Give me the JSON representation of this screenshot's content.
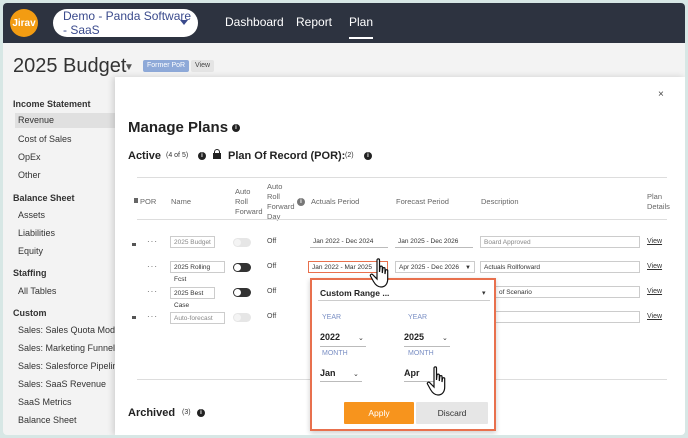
{
  "topbar": {
    "logo_text": "Jirav",
    "workspace": "Demo - Panda Software - SaaS",
    "nav": [
      "Dashboard",
      "Report",
      "Plan"
    ],
    "active_nav": "Plan"
  },
  "page": {
    "title": "2025 Budget",
    "badges": [
      "Former PoR",
      "View"
    ]
  },
  "sidebar": {
    "income_statement": {
      "heading": "Income Statement",
      "items": [
        "Revenue",
        "Cost of Sales",
        "OpEx",
        "Other"
      ],
      "selected": "Revenue"
    },
    "balance_sheet": {
      "heading": "Balance Sheet",
      "items": [
        "Assets",
        "Liabilities",
        "Equity"
      ]
    },
    "staffing": {
      "heading": "Staffing",
      "items": [
        "All Tables"
      ]
    },
    "custom": {
      "heading": "Custom",
      "items": [
        "Sales: Sales Quota Model",
        "Sales: Marketing Funnel",
        "Sales: Salesforce Pipeline",
        "Sales: SaaS Revenue",
        "SaaS Metrics",
        "Balance Sheet"
      ]
    }
  },
  "modal": {
    "close": "×",
    "title": "Manage Plans",
    "active_label": "Active",
    "active_count": "(4 of 5)",
    "por_label": "Plan Of Record (POR):",
    "por_count": "(2)",
    "archived_label": "Archived",
    "archived_count": "(3)",
    "columns": {
      "por": "POR",
      "name": "Name",
      "auto_roll_forward": "Auto Roll Forward",
      "auto_roll_forward_day": "Auto Roll Forward Day",
      "actuals_period": "Actuals Period",
      "forecast_period": "Forecast Period",
      "description": "Description",
      "plan_details": "Plan Details"
    },
    "rows": [
      {
        "name": "2025 Budget",
        "toggle_on": false,
        "day": "Off",
        "actuals": "Jan 2022 - Dec 2024",
        "forecast": "Jan 2025 - Dec 2026",
        "description": "Board Approved",
        "view": "View",
        "dots": "···"
      },
      {
        "name": "2025 Rolling Fcst",
        "toggle_on": true,
        "day": "Off",
        "actuals": "Jan 2022 - Mar 2025",
        "forecast": "Apr 2025 - Dec 2026",
        "description": "Actuals Rollforward",
        "view": "View",
        "dots": "···"
      },
      {
        "name": "2025 Best Case",
        "toggle_on": true,
        "day": "Off",
        "actuals": "",
        "forecast": "",
        "description": "of Scenario",
        "view": "View",
        "dots": "···"
      },
      {
        "name": "Auto-forecast",
        "toggle_on": false,
        "day": "Off",
        "actuals": "",
        "forecast": "",
        "description": "",
        "view": "View",
        "dots": "···"
      }
    ]
  },
  "range_popup": {
    "selected": "Custom Range ...",
    "start": {
      "year_label": "YEAR",
      "year": "2022",
      "month_label": "MONTH",
      "month": "Jan"
    },
    "end": {
      "year_label": "YEAR",
      "year": "2025",
      "month_label": "MONTH",
      "month": "Apr"
    },
    "apply": "Apply",
    "discard": "Discard"
  },
  "colors": {
    "topbar": "#2d3340",
    "accent_orange": "#f7941d",
    "popup_border": "#e8704d",
    "badge_blue": "#8ea9d8"
  },
  "icons": [
    "info-icon",
    "lock-icon",
    "close-icon",
    "chevron-down-icon",
    "hand-cursor-icon"
  ]
}
